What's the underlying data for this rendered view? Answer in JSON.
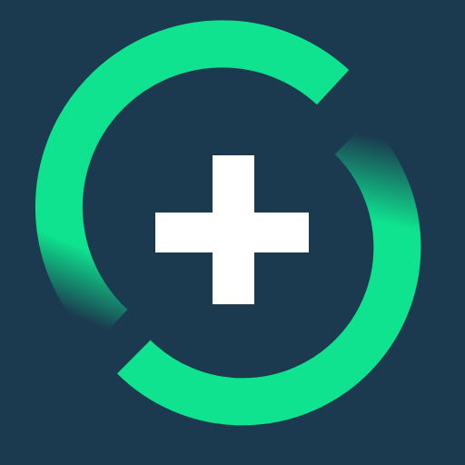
{
  "app_icon": {
    "name": "plus-circle-app-icon",
    "colors": {
      "background": "#1b3a4f",
      "ring": "#0fe38f",
      "plus": "#ffffff"
    },
    "icons": [
      "refresh-ring-icon",
      "plus-icon"
    ]
  }
}
